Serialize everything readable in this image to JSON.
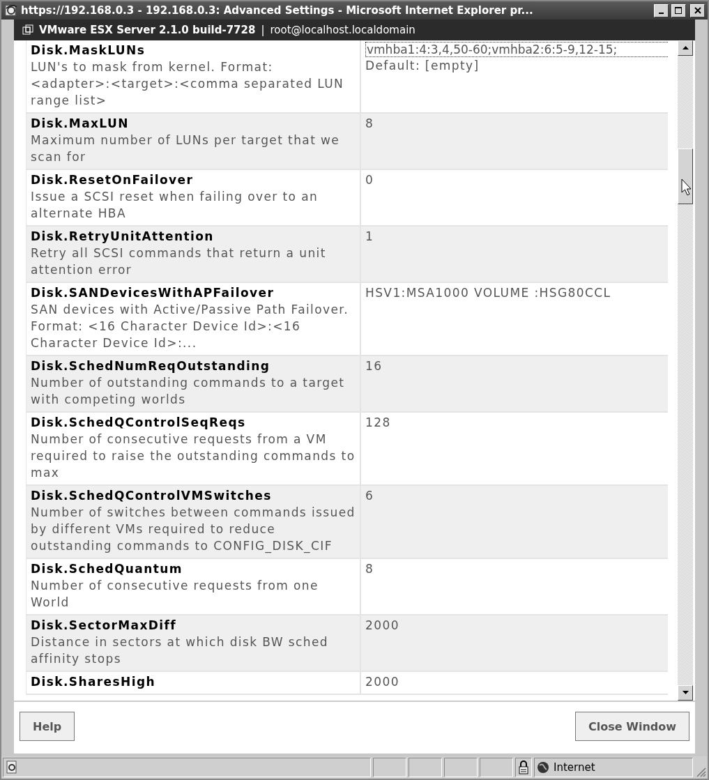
{
  "window": {
    "title": "https://192.168.0.3 - 192.168.0.3: Advanced Settings - Microsoft Internet Explorer pr..."
  },
  "header": {
    "product": "VMware ESX Server 2.1.0 build-7728",
    "separator": "|",
    "user": "root@localhost.localdomain"
  },
  "settings": [
    {
      "name": "Disk.MaskLUNs",
      "description": "LUN's to mask from kernel. Format: <adapter>:<target>:<comma separated LUN range list>",
      "kind": "field",
      "value": "vmhba1:4:3,4,50-60;vmhba2:6:5-9,12-15;",
      "default": "Default: [empty]"
    },
    {
      "name": "Disk.MaxLUN",
      "description": "Maximum number of LUNs per target that we scan for",
      "kind": "text",
      "value": "8"
    },
    {
      "name": "Disk.ResetOnFailover",
      "description": "Issue a SCSI reset when failing over to an alternate HBA",
      "kind": "text",
      "value": "0"
    },
    {
      "name": "Disk.RetryUnitAttention",
      "description": "Retry all SCSI commands that return a unit attention error",
      "kind": "text",
      "value": "1"
    },
    {
      "name": "Disk.SANDevicesWithAPFailover",
      "description": "SAN devices with Active/Passive Path Failover. Format: <16 Character Device Id>:<16 Character Device Id>:...",
      "kind": "text",
      "value": "HSV1:MSA1000 VOLUME :HSG80CCL"
    },
    {
      "name": "Disk.SchedNumReqOutstanding",
      "description": "Number of outstanding commands to a target with competing worlds",
      "kind": "text",
      "value": "16"
    },
    {
      "name": "Disk.SchedQControlSeqReqs",
      "description": "Number of consecutive requests from a VM required to raise the outstanding commands to max",
      "kind": "text",
      "value": "128"
    },
    {
      "name": "Disk.SchedQControlVMSwitches",
      "description": "Number of switches between commands issued by different VMs required to reduce outstanding commands to CONFIG_DISK_CIF",
      "kind": "text",
      "value": "6"
    },
    {
      "name": "Disk.SchedQuantum",
      "description": "Number of consecutive requests from one World",
      "kind": "text",
      "value": "8"
    },
    {
      "name": "Disk.SectorMaxDiff",
      "description": "Distance in sectors at which disk BW sched affinity stops",
      "kind": "text",
      "value": "2000"
    },
    {
      "name": "Disk.SharesHigh",
      "kind": "text",
      "value": "2000"
    }
  ],
  "buttons": {
    "help": "Help",
    "close": "Close Window"
  },
  "status_bar": {
    "zone": "Internet"
  }
}
